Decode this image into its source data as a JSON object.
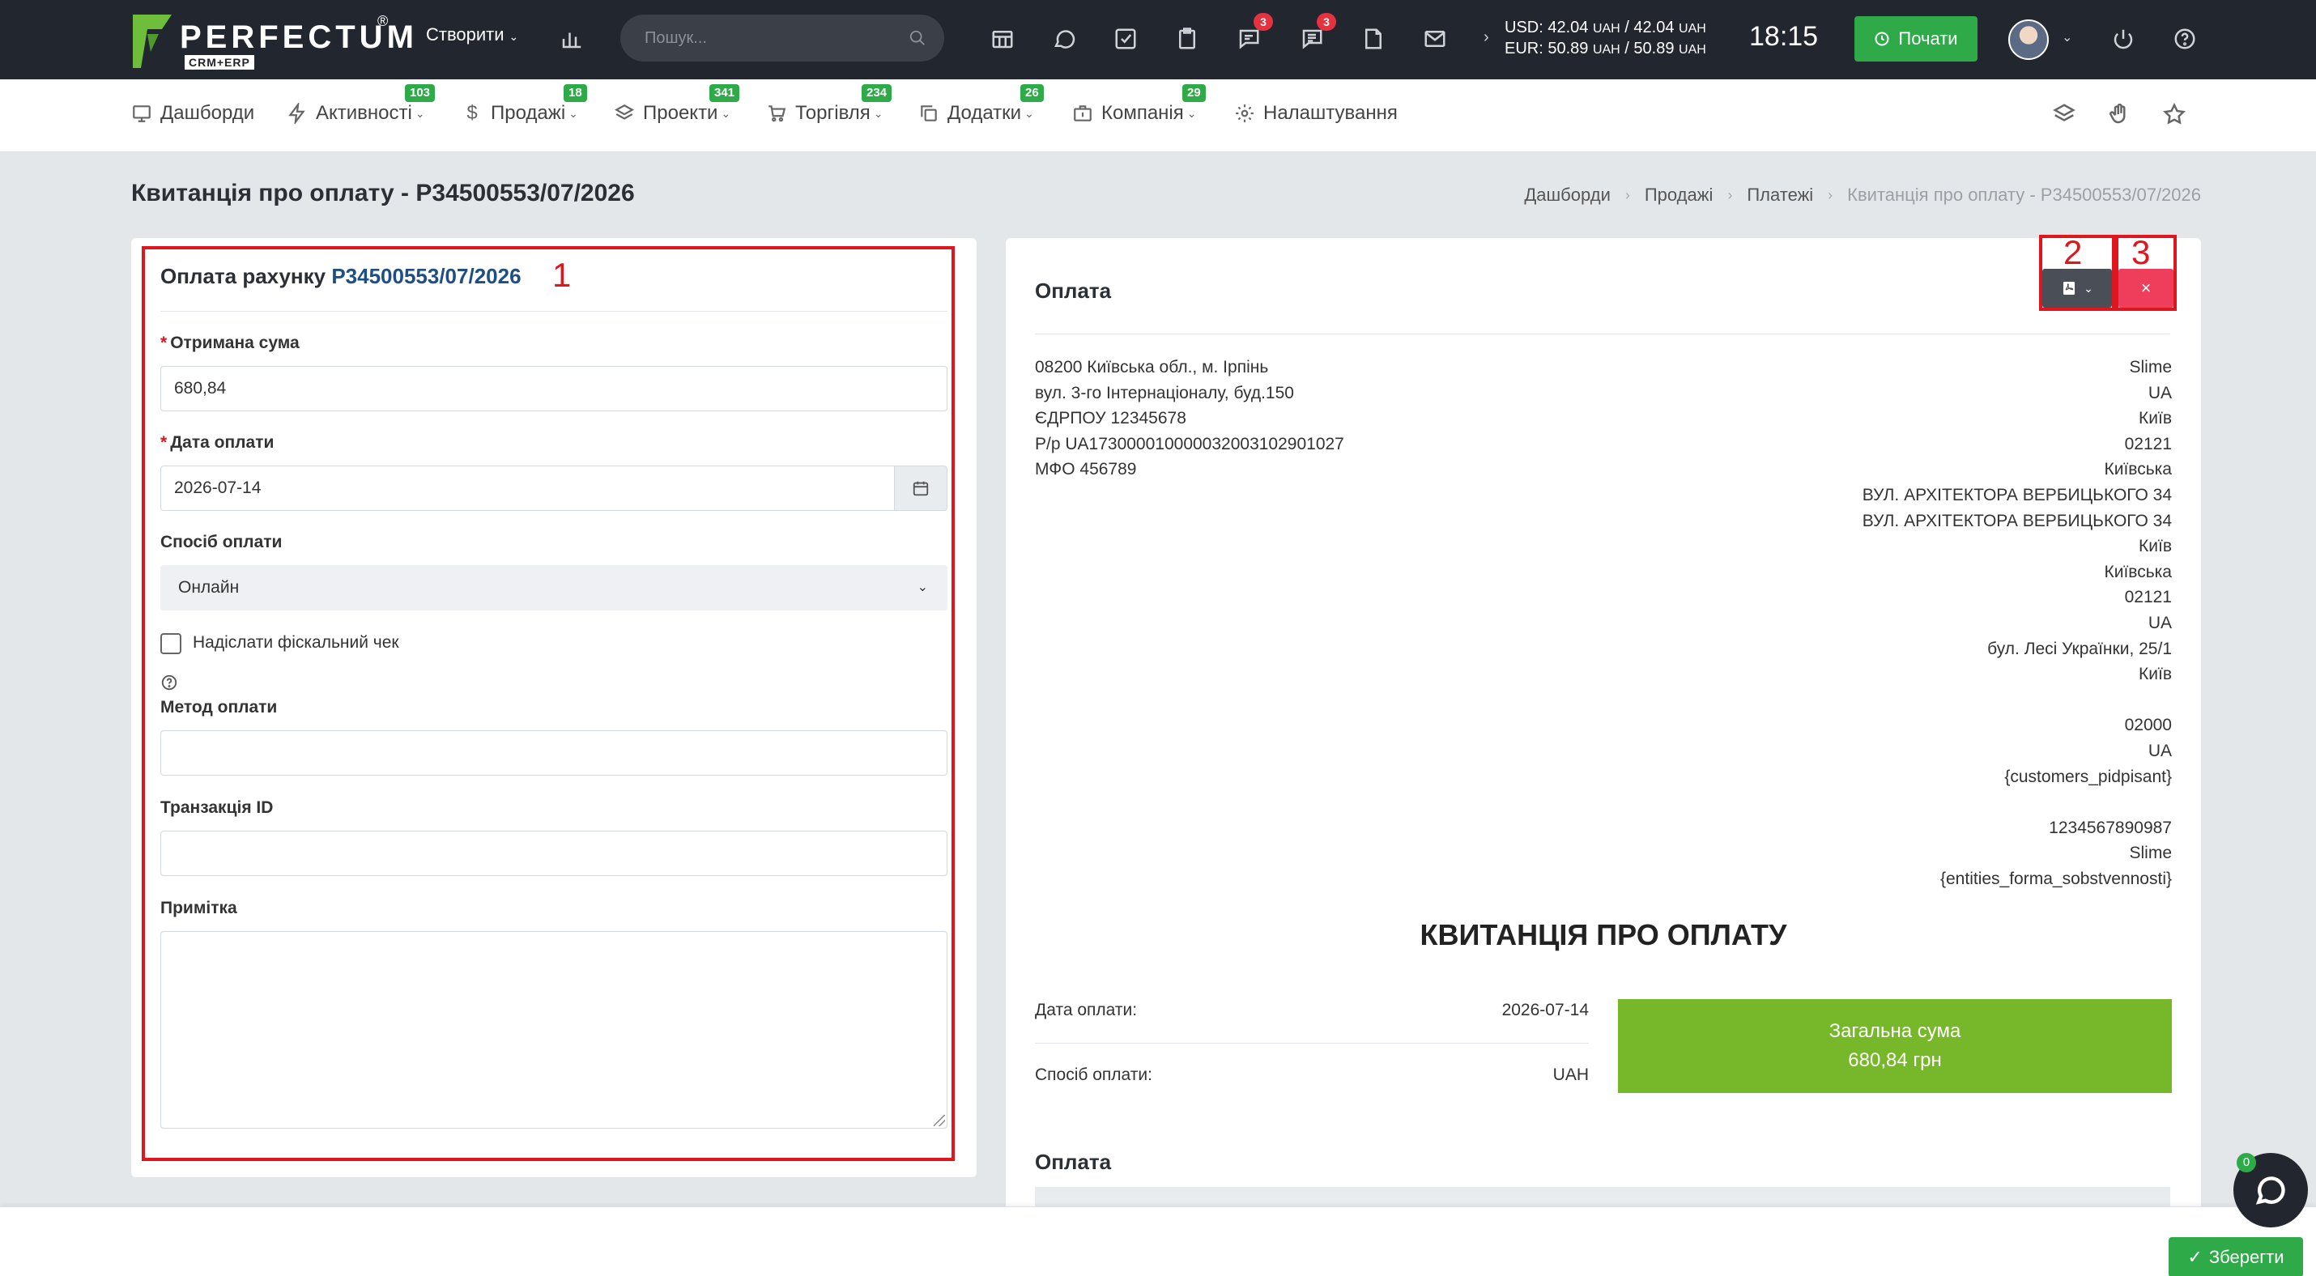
{
  "topbar": {
    "logo_text": "PERFECTUM",
    "logo_reg": "®",
    "logo_sub": "CRM+ERP",
    "create_label": "Створити",
    "search_placeholder": "Пошук...",
    "badges": {
      "chat": "3",
      "messages": "3"
    },
    "currency": {
      "usd_label": "USD: 42.04",
      "usd_unit1": "UAH",
      "usd_sep": "/ 42.04",
      "usd_unit2": "UAH",
      "eur_label": "EUR: 50.89",
      "eur_unit1": "UAH",
      "eur_sep": "/ 50.89",
      "eur_unit2": "UAH"
    },
    "clock": "18:15",
    "start_label": "Почати"
  },
  "subnav": {
    "items": [
      {
        "label": "Дашборди",
        "badge": ""
      },
      {
        "label": "Активності",
        "badge": "103"
      },
      {
        "label": "Продажі",
        "badge": "18"
      },
      {
        "label": "Проекти",
        "badge": "341"
      },
      {
        "label": "Торгівля",
        "badge": "234"
      },
      {
        "label": "Додатки",
        "badge": "26"
      },
      {
        "label": "Компанія",
        "badge": "29"
      },
      {
        "label": "Налаштування",
        "badge": ""
      }
    ]
  },
  "page": {
    "title": "Квитанція про оплату - P34500553/07/2026",
    "breadcrumb": [
      "Дашборди",
      "Продажі",
      "Платежі",
      "Квитанція про оплату - P34500553/07/2026"
    ]
  },
  "form": {
    "title_prefix": "Оплата рахунку",
    "title_link": "P34500553/07/2026",
    "marker": "1",
    "amount_label": "Отримана сума",
    "amount_value": "680,84",
    "date_label": "Дата оплати",
    "date_value": "2026-07-14",
    "method_label": "Спосіб оплати",
    "method_value": "Онлайн",
    "fiscal_label": "Надіслати фіскальний чек",
    "pay_method_label": "Метод оплати",
    "pay_method_value": "",
    "transaction_label": "Транзакція ID",
    "transaction_value": "",
    "note_label": "Примітка",
    "note_value": "",
    "required_mark": "*"
  },
  "receipt": {
    "title": "Оплата",
    "marker_pdf": "2",
    "marker_close": "3",
    "close_glyph": "×",
    "company_lines": [
      "08200 Київська обл., м. Ірпінь",
      "вул. 3-го Інтернаціоналу, буд.150",
      "ЄДРПОУ 12345678",
      "Р/р UA173000010000032003102901027",
      "МФО 456789"
    ],
    "customer_lines": [
      "Slime",
      "UA",
      "Київ",
      "02121",
      "Київська",
      "ВУЛ. АРХІТЕКТОРА ВЕРБИЦЬКОГО 34",
      "ВУЛ. АРХІТЕКТОРА ВЕРБИЦЬКОГО 34",
      "Київ",
      "Київська",
      "02121",
      "UA",
      "бул. Лесі Українки, 25/1",
      "Київ",
      "",
      "02000",
      "UA",
      "{customers_pidpisant}",
      "",
      "1234567890987",
      "Slime",
      "{entities_forma_sobstvennosti}"
    ],
    "heading": "КВИТАНЦІЯ ПРО ОПЛАТУ",
    "date_label": "Дата оплати:",
    "date_value": "2026-07-14",
    "method_label": "Спосіб оплати:",
    "method_value": "UAH",
    "total_label": "Загальна сума",
    "total_value": "680,84 грн",
    "subtitle": "Оплата"
  },
  "bottom": {
    "save_label": "Зберегти",
    "chat_badge": "0"
  },
  "colors": {
    "topbar": "#22262e",
    "accent_green": "#2eab48",
    "total_green": "#76b82a",
    "danger": "#ee3e5b",
    "highlight_red": "#e0161e",
    "link_blue": "#1f4e86"
  }
}
